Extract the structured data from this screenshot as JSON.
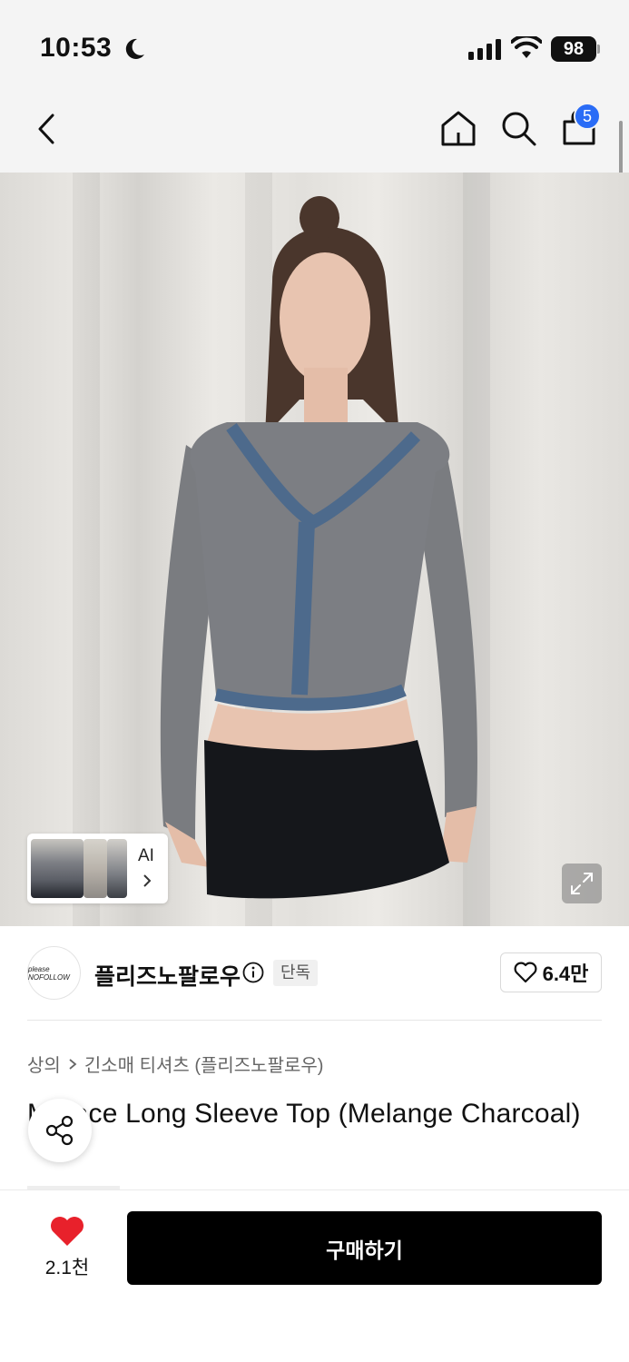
{
  "status_bar": {
    "time": "10:53",
    "battery": "98"
  },
  "nav": {
    "cart_count": "5"
  },
  "gallery": {
    "ai_label": "AI"
  },
  "brand": {
    "name": "플리즈노팔로우",
    "logo_text": "please NOFOLLOW",
    "badge": "단독",
    "likes": "6.4만"
  },
  "breadcrumb": {
    "category": "상의",
    "subcategory": "긴소매 티셔츠 (플리즈노팔로우)"
  },
  "product": {
    "title": "M Lace Long Sleeve Top (Melange Charcoal)",
    "title_visible": "M   Lace Long Sleeve Top (Melange Char\nc   l)"
  },
  "bottom_bar": {
    "wish_count": "2.1천",
    "buy_label": "구매하기"
  },
  "colors": {
    "accent_badge": "#2a6cf6",
    "heart": "#e8212b",
    "buy_button": "#000000"
  }
}
